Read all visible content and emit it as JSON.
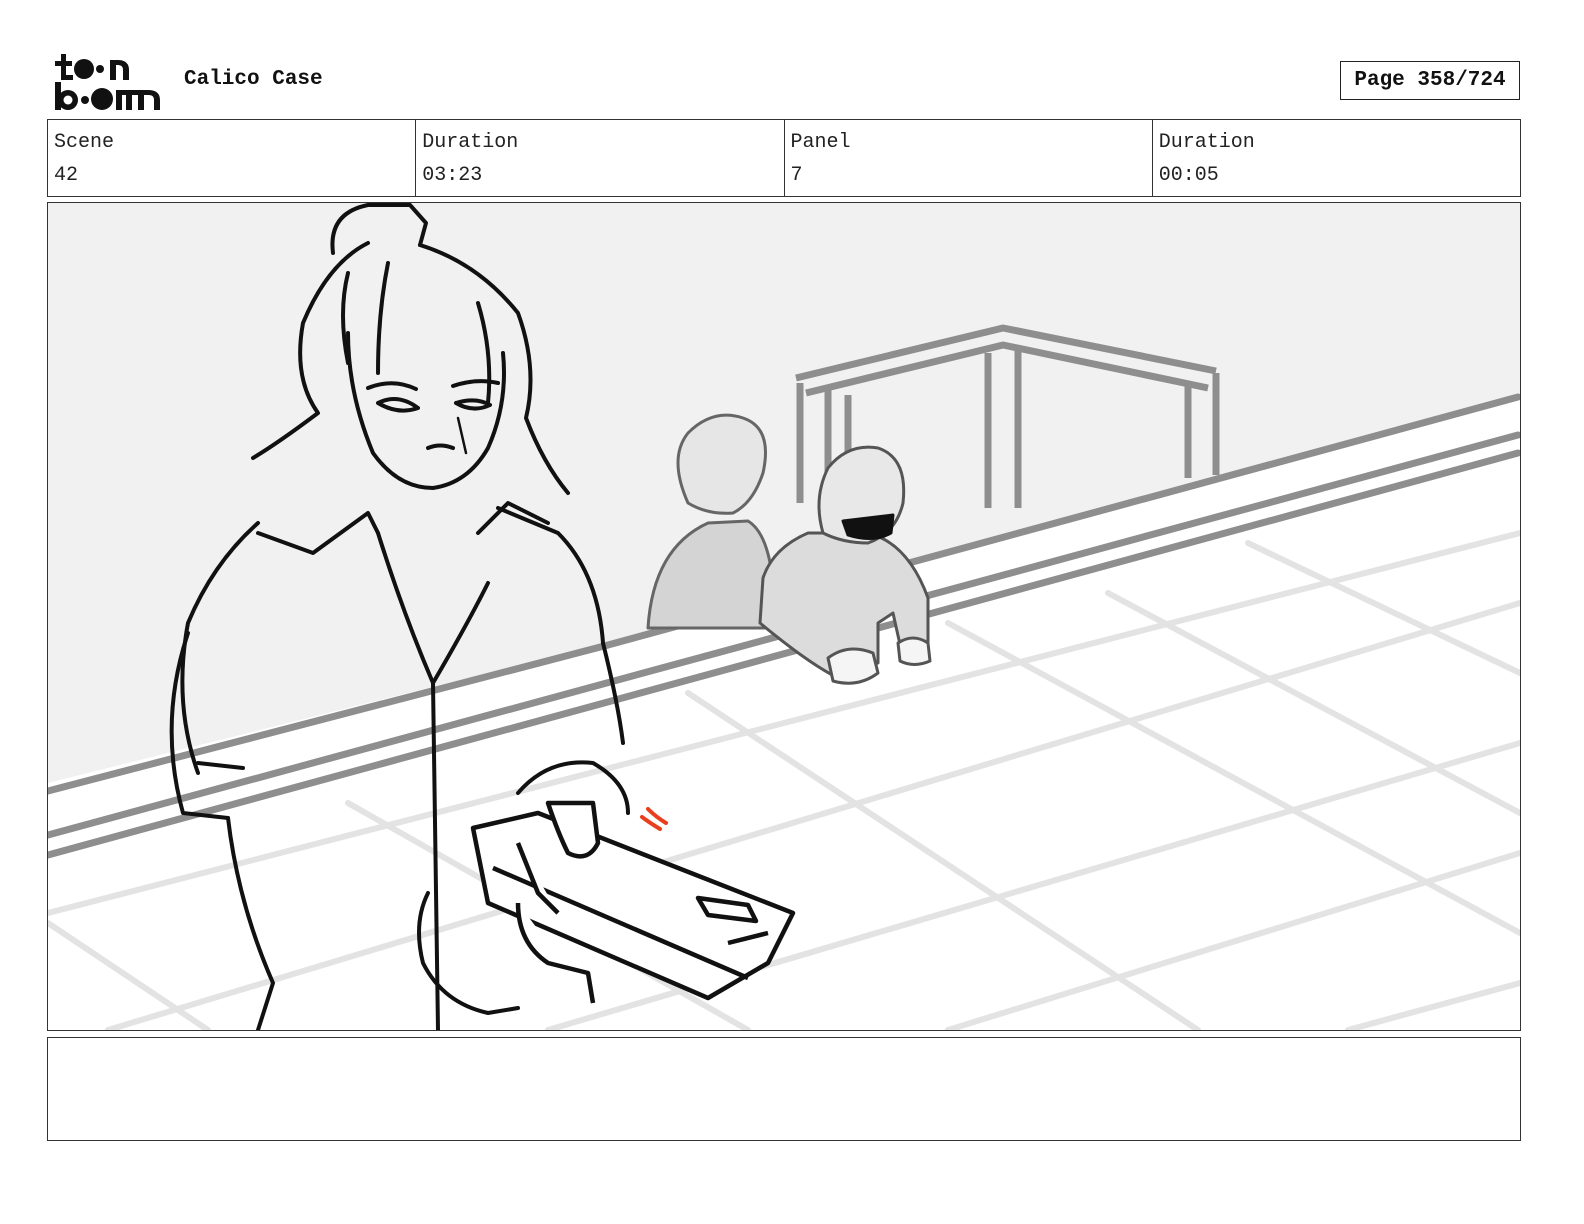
{
  "header": {
    "logo_alt": "toon boom",
    "project_title": "Calico Case",
    "page_label": "Page 358/724"
  },
  "info": {
    "scene_label": "Scene",
    "scene_value": "42",
    "scene_duration_label": "Duration",
    "scene_duration_value": "03:23",
    "panel_label": "Panel",
    "panel_value": "7",
    "panel_duration_label": "Duration",
    "panel_duration_value": "00:05"
  },
  "notes": {
    "text": ""
  },
  "colors": {
    "line": "#111111",
    "background_wall": "#f1f1f1",
    "grey_structure": "#8f8f8f",
    "floor_grid": "#e2e2e2",
    "accent_mark": "#e8401c"
  }
}
